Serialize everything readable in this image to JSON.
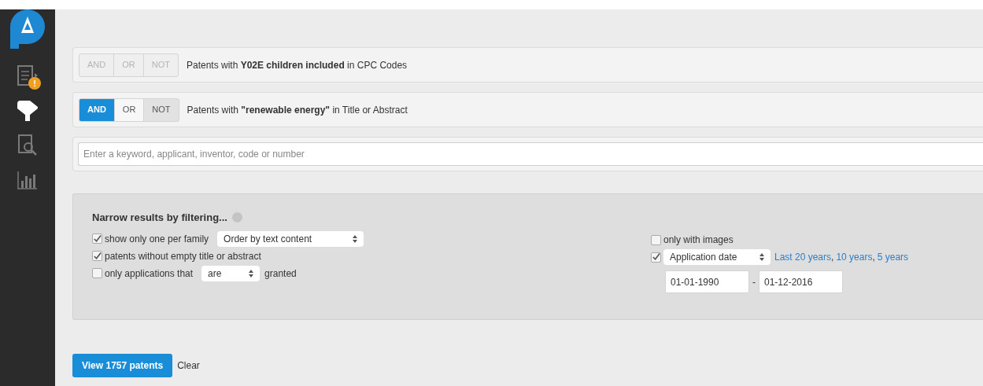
{
  "sidebar": {
    "items": [
      {
        "kind": "document",
        "selected": false,
        "badge": "!"
      },
      {
        "kind": "filter",
        "selected": true
      },
      {
        "kind": "search",
        "selected": false
      },
      {
        "kind": "chart",
        "selected": false
      }
    ]
  },
  "query_rows": [
    {
      "disabled": true,
      "operators": [
        {
          "label": "AND",
          "selected": false
        },
        {
          "label": "OR",
          "selected": false
        },
        {
          "label": "NOT",
          "selected": false
        }
      ],
      "text": "Patents with **Y02E children included** in CPC Codes"
    },
    {
      "disabled": false,
      "operators": [
        {
          "label": "AND",
          "selected": true
        },
        {
          "label": "OR",
          "selected": false
        },
        {
          "label": "NOT",
          "selected": false
        }
      ],
      "text": "Patents with **\"renewable energy\"** in Title or Abstract"
    }
  ],
  "search": {
    "placeholder": "Enter a keyword, applicant, inventor, code or number"
  },
  "filters": {
    "title": "Narrow results by filtering...",
    "left": [
      {
        "checked": true,
        "label": "show only one per family",
        "select": "Order by text content"
      },
      {
        "checked": true,
        "label": "patents without empty title or abstract"
      },
      {
        "checked": false,
        "label": "only applications that",
        "select": "are",
        "suffix": "granted"
      }
    ],
    "right": {
      "images": {
        "checked": false,
        "label": "only with images"
      },
      "date": {
        "checked": true,
        "select": "Application date",
        "links": [
          "Last 20 years",
          "10 years",
          "5 years"
        ],
        "link_separator": ",",
        "from": "01-01-1990",
        "range_separator": "-",
        "to": "01-12-2016"
      }
    }
  },
  "actions": {
    "primary": "View 1757 patents",
    "secondary": "Clear"
  }
}
